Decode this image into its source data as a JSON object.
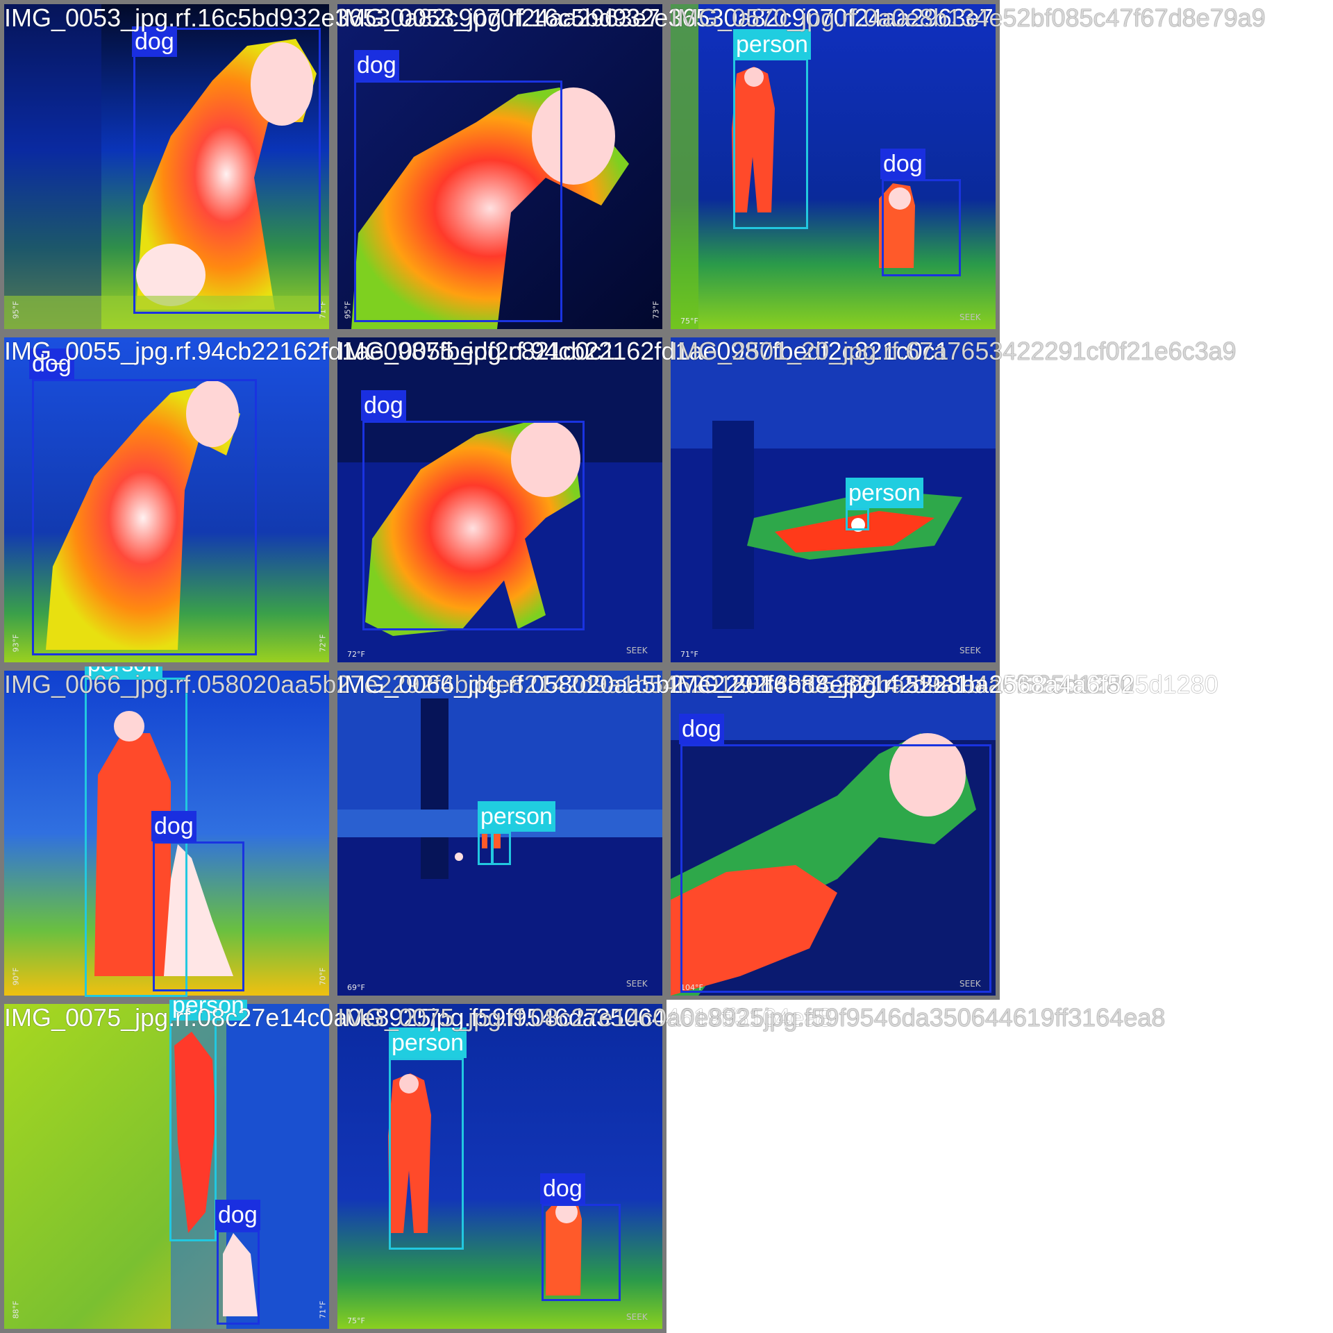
{
  "tiles": [
    {
      "filename": "IMG_0053_jpg.rf.16c5bd932e36530a82c9070f24aa2963e7",
      "temp_readouts": [
        "95°F",
        "71°F"
      ],
      "brand": "",
      "labels": [
        "dog"
      ]
    },
    {
      "filename": "IMG_0053_jpg.rf.16c5bd932e36530a82c9070f24aa2963e7",
      "temp_readouts": [
        "95°F",
        "73°F"
      ],
      "brand": "",
      "labels": [
        "dog"
      ]
    },
    {
      "filename": "IMG_0570_jpg.rf.0a0e8b134e52bf085c47f67d8e79a9",
      "temp_readouts": [
        "75°F"
      ],
      "brand": "SEEK",
      "labels": [
        "person",
        "dog"
      ]
    },
    {
      "filename": "IMG_0055_jpg.rf.94cb22162fd1ae0987fbedf2c821c0c1",
      "temp_readouts": [
        "93°F",
        "72°F"
      ],
      "brand": "",
      "labels": [
        "dog"
      ]
    },
    {
      "filename": "IMG_0055_jpg.rf.94cb22162fd1ae0987fbedf2c821c0c1",
      "temp_readouts": [
        "72°F"
      ],
      "brand": "SEEK",
      "labels": [
        "dog"
      ]
    },
    {
      "filename": "IMG_2501_20_jpg.rf.67a7653422291cf0f21e6c3a9",
      "temp_readouts": [
        "71°F"
      ],
      "brand": "SEEK",
      "labels": [
        "person"
      ]
    },
    {
      "filename": "IMG_0066_jpg.rf.058020aa5b27e2292f4bd4e82142d9a1b5462016888cf05228ba2568a4a6f525d1280",
      "temp_readouts": [
        "90°F",
        "70°F"
      ],
      "brand": "",
      "labels": [
        "person",
        "dog"
      ]
    },
    {
      "filename": "IMG_0066_jpg.rf.058020aa5b27e2292f4bd4e82142d9a1b",
      "temp_readouts": [
        "69°F"
      ],
      "brand": "SEEK",
      "labels": [
        "person"
      ]
    },
    {
      "filename": "IMG_2016888_jpg.rf.5228ba2568a4a6f525d1280",
      "temp_readouts": [
        "104°F"
      ],
      "brand": "SEEK",
      "labels": [
        "dog"
      ]
    },
    {
      "filename": "IMG_0075_jpg.rf.08c27e14c0a0e8925jpg.f59f9546da350644619ff3164ea8",
      "temp_readouts": [
        "88°F",
        "71°F"
      ],
      "brand": "",
      "labels": [
        "person",
        "dog"
      ]
    },
    {
      "filename": "IMG_0075_jpg.rf.08c27e14c0a0e8925jpg.f59f9546da350644619ff3164ea8",
      "temp_readouts": [
        "75°F"
      ],
      "brand": "SEEK",
      "labels": [
        "person",
        "dog"
      ]
    }
  ],
  "colors": {
    "dog_box": "#1a2fe0",
    "person_box": "#20cde0",
    "tile_border": "#7a7a7a"
  }
}
